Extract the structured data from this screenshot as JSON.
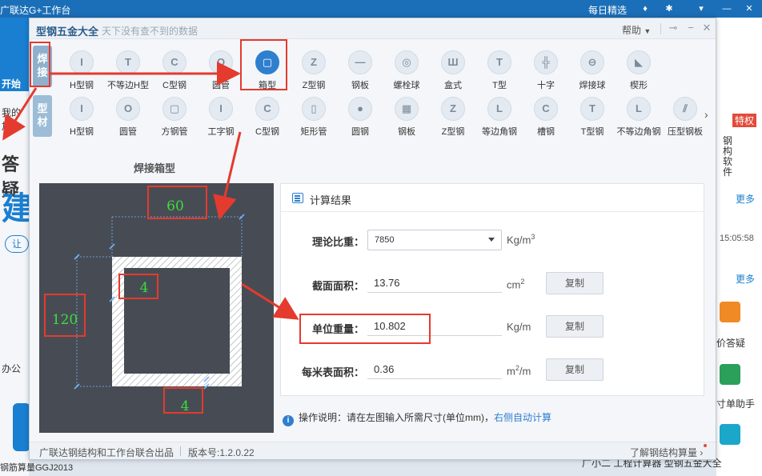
{
  "background": {
    "top_left_text": "广联达G+工作台",
    "top_right_text": "每日精选",
    "left_texts": [
      "开始",
      "我的加",
      "答疑",
      "建",
      "让",
      "办公"
    ],
    "right_more": [
      "更多",
      "更多"
    ],
    "right_time": "15:05:58",
    "right_labels": [
      "价答疑",
      "寸单助手",
      "钢构软件",
      "特权"
    ],
    "bottom_left": "钢筋算量GGJ2013",
    "bottom_right": "广小二    工程计算器   型钢五金大全"
  },
  "dialog": {
    "title": "型钢五金大全",
    "subtitle": "天下没有查不到的数据",
    "help": "帮助",
    "categories": {
      "weld": "焊接",
      "material": "型材"
    },
    "weld_shapes": [
      {
        "name": "H型钢",
        "glyph": "I"
      },
      {
        "name": "不等边H型",
        "glyph": "T"
      },
      {
        "name": "C型钢",
        "glyph": "C"
      },
      {
        "name": "圆管",
        "glyph": "O"
      },
      {
        "name": "箱型",
        "glyph": "▢"
      },
      {
        "name": "Z型钢",
        "glyph": "Z"
      },
      {
        "name": "钢板",
        "glyph": "—"
      },
      {
        "name": "螺栓球",
        "glyph": "◎"
      },
      {
        "name": "盒式",
        "glyph": "Ш"
      },
      {
        "name": "T型",
        "glyph": "T"
      },
      {
        "name": "十字",
        "glyph": "╬"
      },
      {
        "name": "焊接球",
        "glyph": "⊖"
      },
      {
        "name": "楔形",
        "glyph": "◣"
      }
    ],
    "material_shapes": [
      {
        "name": "H型钢",
        "glyph": "I"
      },
      {
        "name": "圆管",
        "glyph": "O"
      },
      {
        "name": "方钢管",
        "glyph": "▢"
      },
      {
        "name": "工字钢",
        "glyph": "I"
      },
      {
        "name": "C型钢",
        "glyph": "C"
      },
      {
        "name": "矩形管",
        "glyph": "▯"
      },
      {
        "name": "圆钢",
        "glyph": "●"
      },
      {
        "name": "钢板",
        "glyph": "▦"
      },
      {
        "name": "Z型钢",
        "glyph": "Z"
      },
      {
        "name": "等边角钢",
        "glyph": "L"
      },
      {
        "name": "槽钢",
        "glyph": "C"
      },
      {
        "name": "T型钢",
        "glyph": "T"
      },
      {
        "name": "不等边角钢",
        "glyph": "L"
      },
      {
        "name": "压型钢板",
        "glyph": "⫽"
      }
    ],
    "section_title": "焊接箱型",
    "drawing": {
      "width": "60",
      "height": "120",
      "flange_thickness": "4",
      "web_thickness": "4"
    },
    "results": {
      "header": "计算结果",
      "density_label": "理论比重：",
      "density_value": "7850",
      "density_unit": "Kg/m",
      "density_unit_sup": "3",
      "area_label": "截面面积：",
      "area_value": "13.76",
      "area_unit": "cm",
      "area_unit_sup": "2",
      "weight_label": "单位重量：",
      "weight_value": "10.802",
      "weight_unit": "Kg/m",
      "surface_label": "每米表面积：",
      "surface_value": "0.36",
      "surface_unit_pre": "m",
      "surface_unit_sup": "2",
      "surface_unit_post": "/m",
      "copy": "复制"
    },
    "hint": {
      "text": "操作说明：请在左图输入所需尺寸(单位mm)，",
      "link": "右侧自动计算"
    },
    "footer": {
      "publisher": "广联达钢结构和工作台联合出品",
      "version": "版本号:1.2.0.22",
      "learn_more": "了解钢结构算量"
    }
  },
  "colors": {
    "accent": "#2f7fcf",
    "annotation": "#e53a2e",
    "drawing_bg": "#474c54",
    "dimension_text": "#3ddc3d"
  }
}
